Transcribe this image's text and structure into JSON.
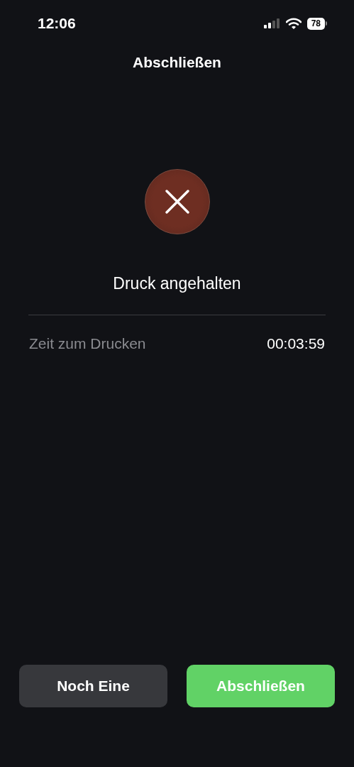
{
  "status_bar": {
    "time": "12:06",
    "battery": "78"
  },
  "title": "Abschließen",
  "result": {
    "kind": "stopped",
    "message": "Druck angehalten"
  },
  "details": [
    {
      "label": "Zeit zum Drucken",
      "value": "00:03:59"
    }
  ],
  "buttons": [
    {
      "label": "Noch Eine",
      "kind": "secondary"
    },
    {
      "label": "Abschließen",
      "kind": "primary"
    }
  ]
}
